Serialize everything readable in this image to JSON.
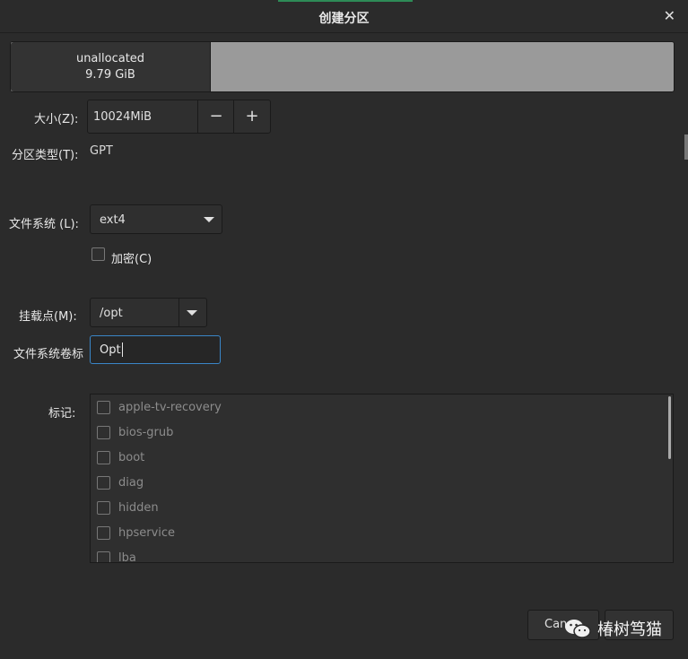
{
  "dialog": {
    "title": "创建分区",
    "close_glyph": "✕"
  },
  "partition_bar": {
    "name": "unallocated",
    "size": "9.79 GiB"
  },
  "size": {
    "label": "大小(Z):",
    "value": "10024MiB",
    "minus": "−",
    "plus": "+"
  },
  "partition_type": {
    "label": "分区类型(T):",
    "value": "GPT"
  },
  "filesystem": {
    "label": "文件系统 (L):",
    "value": "ext4"
  },
  "encrypt": {
    "label": "加密(C)",
    "checked": false
  },
  "mount_point": {
    "label": "挂载点(M):",
    "value": "/opt"
  },
  "fs_label": {
    "label": "文件系统卷标",
    "value": "Opt"
  },
  "flags": {
    "label": "标记:",
    "items": [
      "apple-tv-recovery",
      "bios-grub",
      "boot",
      "diag",
      "hidden",
      "hpservice",
      "lba"
    ]
  },
  "buttons": {
    "cancel_partial": "Can"
  },
  "watermark": {
    "text": "椿树笃猫"
  },
  "colors": {
    "accent": "#2e8b57",
    "focus": "#3a86c8",
    "background": "#2b2b2b"
  }
}
